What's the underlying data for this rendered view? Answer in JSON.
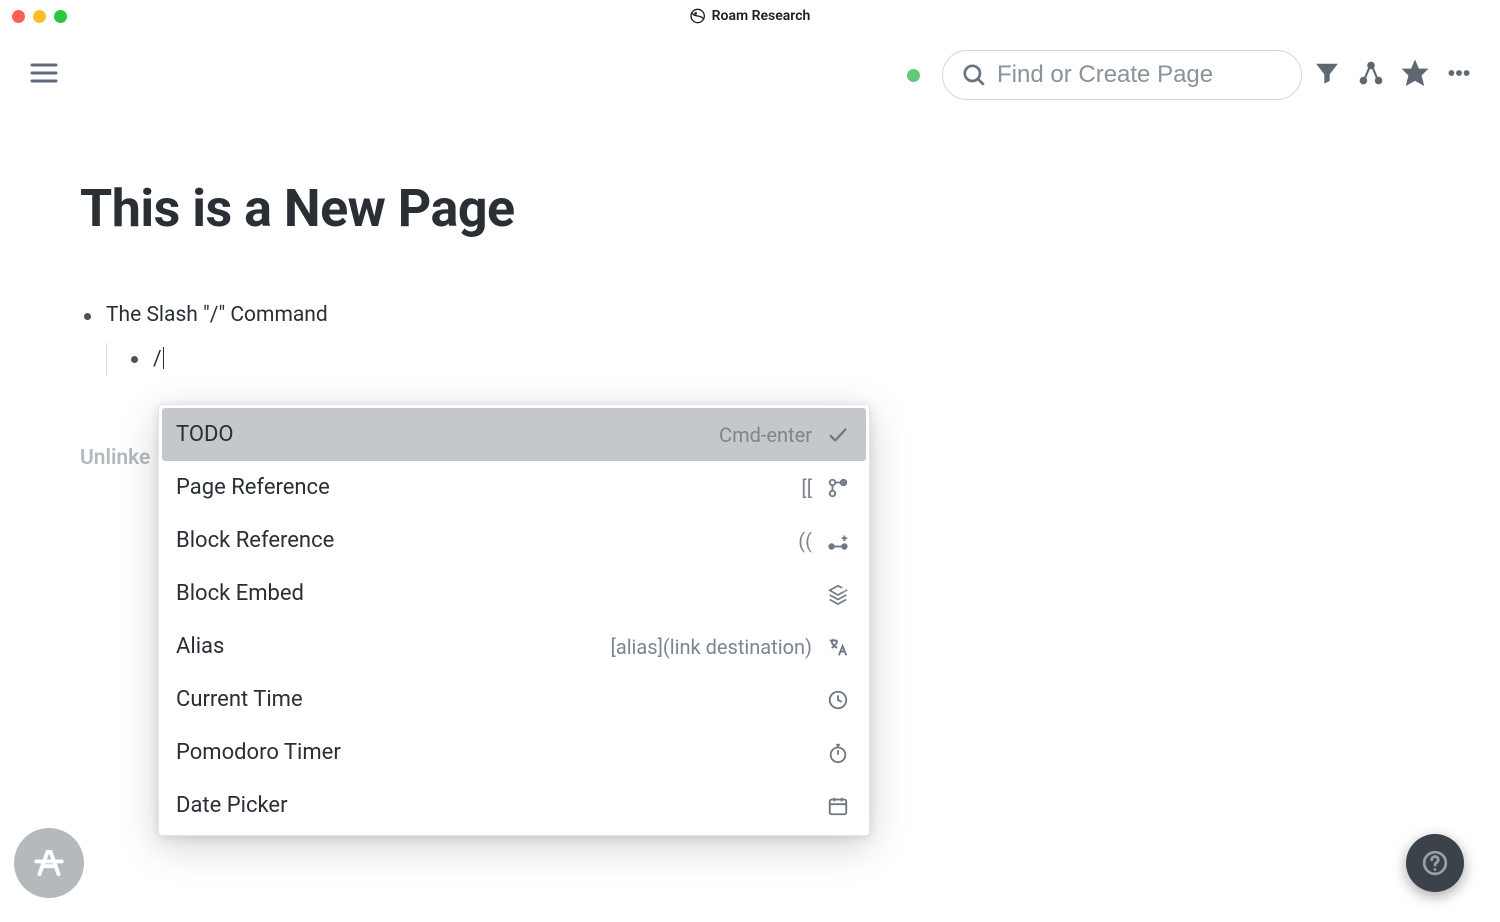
{
  "window": {
    "title": "Roam Research"
  },
  "toolbar": {
    "search_placeholder": "Find or Create Page"
  },
  "page": {
    "title": "This is a New Page",
    "blocks": {
      "first": "The Slash \"/\" Command",
      "second": "/"
    },
    "unlinked_label": "Unlinke"
  },
  "slash_menu": {
    "items": [
      {
        "label": "TODO",
        "hint": "Cmd-enter",
        "icon": "check-icon"
      },
      {
        "label": "Page Reference",
        "hint": "[[",
        "icon": "branch-icon"
      },
      {
        "label": "Block Reference",
        "hint": "((",
        "icon": "connect-icon"
      },
      {
        "label": "Block Embed",
        "hint": "",
        "icon": "layers-icon"
      },
      {
        "label": "Alias",
        "hint": "[alias](link destination)",
        "icon": "translate-icon"
      },
      {
        "label": "Current Time",
        "hint": "",
        "icon": "clock-icon"
      },
      {
        "label": "Pomodoro Timer",
        "hint": "",
        "icon": "stopwatch-icon"
      },
      {
        "label": "Date Picker",
        "hint": "",
        "icon": "calendar-icon"
      }
    ]
  }
}
